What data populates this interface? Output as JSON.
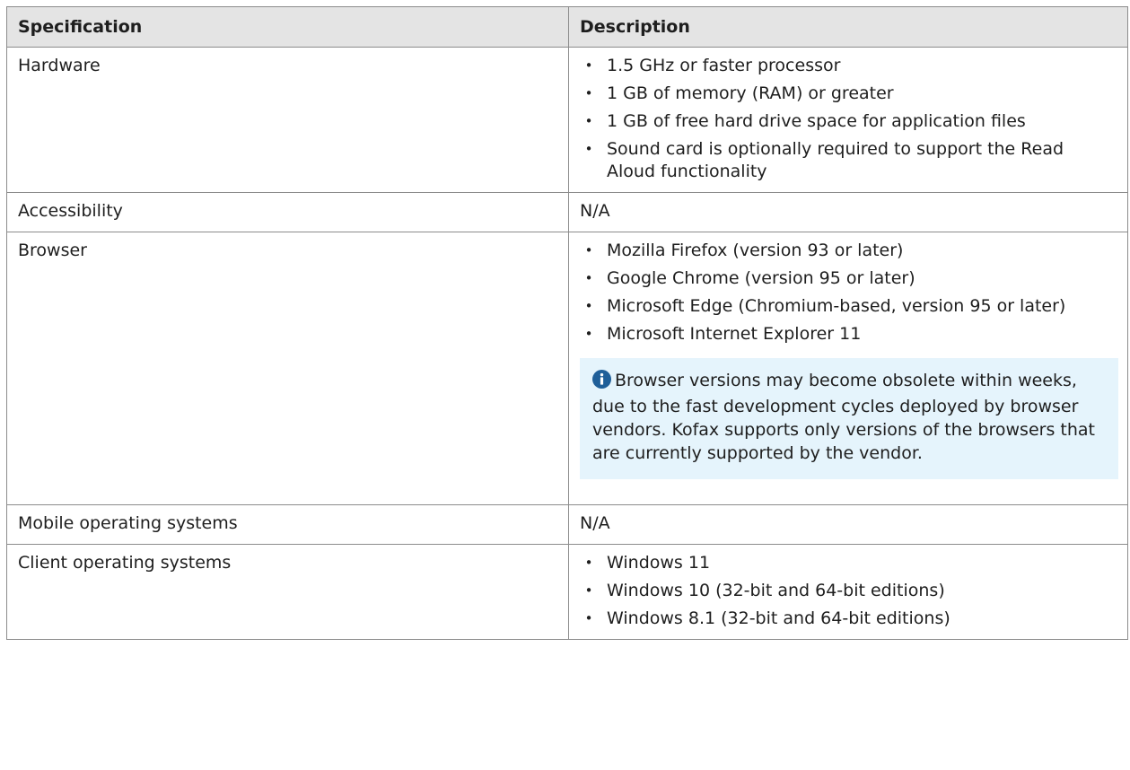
{
  "table": {
    "headers": {
      "specification": "Specification",
      "description": "Description"
    },
    "rows": [
      {
        "spec": "Hardware",
        "bullets": [
          "1.5 GHz or faster processor",
          "1 GB of memory (RAM) or greater",
          "1 GB of free hard drive space for application files",
          "Sound card is optionally required to support the Read Aloud functionality"
        ]
      },
      {
        "spec": "Accessibility",
        "text": "N/A"
      },
      {
        "spec": "Browser",
        "bullets": [
          "Mozilla Firefox (version 93 or later)",
          "Google Chrome (version 95 or later)",
          "Microsoft Edge (Chromium-based, version 95 or later)",
          "Microsoft Internet Explorer 11"
        ],
        "note": "Browser versions may become obsolete within weeks, due to the fast development cycles deployed by browser vendors. Kofax supports only versions of the browsers that are currently supported by the vendor."
      },
      {
        "spec": "Mobile operating systems",
        "text": "N/A"
      },
      {
        "spec": "Client operating systems",
        "bullets": [
          "Windows 11",
          "Windows 10 (32-bit and 64-bit editions)",
          "Windows 8.1 (32-bit and 64-bit editions)"
        ]
      }
    ]
  },
  "icons": {
    "bullet": "•",
    "note_icon": "info-icon"
  },
  "colors": {
    "header_bg": "#e4e4e4",
    "note_bg": "#e5f4fc",
    "info_icon": "#1f5f99",
    "border": "#8c8c8c"
  }
}
